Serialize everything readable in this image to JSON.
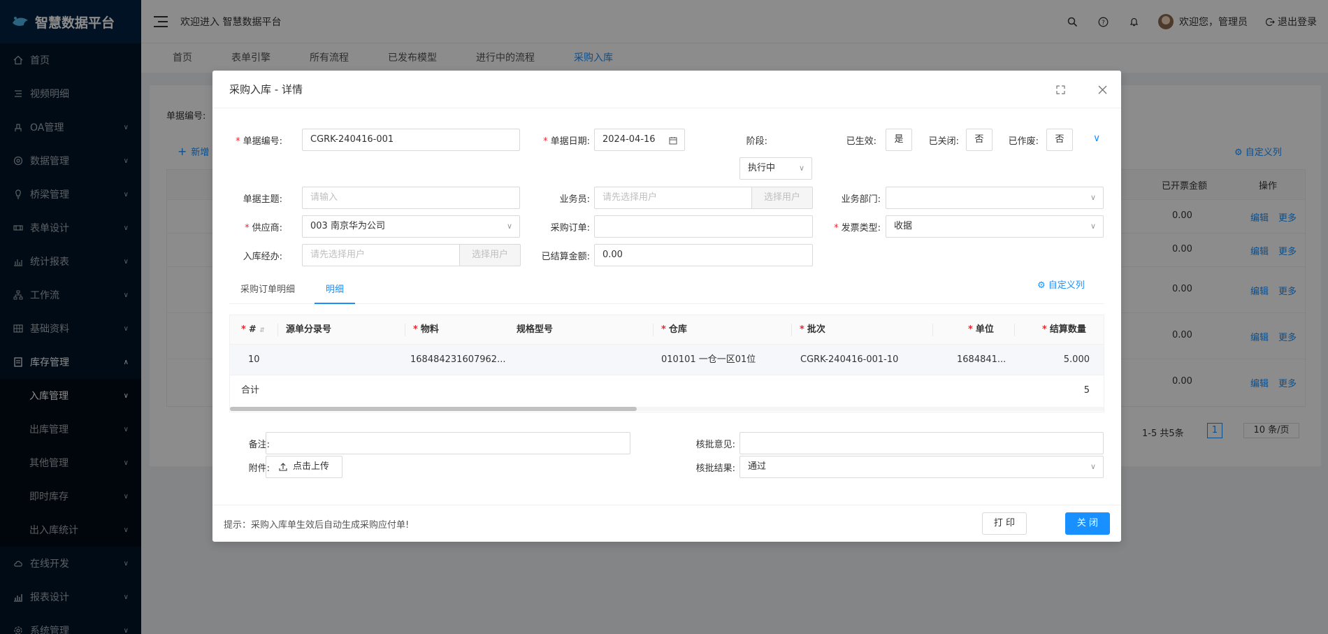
{
  "sidebar": {
    "logo_text": "智慧数据平台",
    "items": [
      {
        "label": "首页",
        "icon": "home-icon"
      },
      {
        "label": "视频明细",
        "icon": "list-icon"
      },
      {
        "label": "OA管理",
        "icon": "user-icon"
      },
      {
        "label": "数据管理",
        "icon": "database-icon"
      },
      {
        "label": "桥梁管理",
        "icon": "bulb-icon"
      },
      {
        "label": "表单设计",
        "icon": "form-icon"
      },
      {
        "label": "统计报表",
        "icon": "bar-chart-icon"
      },
      {
        "label": "工作流",
        "icon": "flow-icon"
      },
      {
        "label": "基础资料",
        "icon": "grid-icon"
      },
      {
        "label": "库存管理",
        "icon": "file-icon"
      }
    ],
    "sub_items": [
      {
        "label": "入库管理"
      },
      {
        "label": "出库管理"
      },
      {
        "label": "其他管理"
      },
      {
        "label": "即时库存"
      },
      {
        "label": "出入库统计"
      }
    ],
    "bottom_items": [
      {
        "label": "在线开发",
        "icon": "cloud-icon"
      },
      {
        "label": "报表设计",
        "icon": "chart-icon"
      },
      {
        "label": "系统管理",
        "icon": "setting-icon"
      }
    ]
  },
  "header": {
    "title": "欢迎进入 智慧数据平台",
    "user_greeting": "欢迎您，管理员",
    "logout": "退出登录"
  },
  "tabs": [
    "首页",
    "表单引擎",
    "所有流程",
    "已发布模型",
    "进行中的流程",
    "采购入库"
  ],
  "background": {
    "label_order_no": "单据编号:",
    "new_button": "新增",
    "custom_columns": "自定义列",
    "col_invoiced": "已开票金额",
    "col_ops": "操作",
    "row_values": [
      "0.00",
      "0.00",
      "0.00",
      "0.00",
      "0.00"
    ],
    "edit": "编辑",
    "more": "更多",
    "pagination_total": "1-5 共5条",
    "page_current": "1",
    "page_size": "10 条/页"
  },
  "modal": {
    "title": "采购入库 - 详情",
    "fields": {
      "order_no_label": "单据编号:",
      "order_no_value": "CGRK-240416-001",
      "order_date_label": "单据日期:",
      "order_date_value": "2024-04-16",
      "stage_label": "阶段:",
      "stage_value": "执行中",
      "effective_label": "已生效:",
      "effective_value": "是",
      "closed_label": "已关闭:",
      "closed_value": "否",
      "voided_label": "已作废:",
      "voided_value": "否",
      "subject_label": "单据主题:",
      "subject_placeholder": "请输入",
      "salesman_label": "业务员:",
      "salesman_placeholder": "请先选择用户",
      "select_user": "选择用户",
      "department_label": "业务部门:",
      "supplier_label": "供应商:",
      "supplier_value": "003 南京华为公司",
      "purchase_order_label": "采购订单:",
      "invoice_type_label": "发票类型:",
      "invoice_type_value": "收据",
      "handler_label": "入库经办:",
      "handler_placeholder": "请先选择用户",
      "settled_label": "已结算金额:",
      "settled_value": "0.00"
    },
    "custom_columns": "自定义列",
    "tabs": [
      "采购订单明细",
      "明细"
    ],
    "table": {
      "headers": [
        "#",
        "源单分录号",
        "物料",
        "规格型号",
        "仓库",
        "批次",
        "单位",
        "结算数量"
      ],
      "row": [
        "10",
        "",
        "168484231607962...",
        "",
        "010101 一仓一区01位",
        "CGRK-240416-001-10",
        "1684841...",
        "5.000"
      ],
      "sum_label": "合计",
      "sum_value": "5"
    },
    "remark_label": "备注:",
    "attachment_label": "附件:",
    "upload_button": "点击上传",
    "approval_opinion_label": "核批意见:",
    "approval_result_label": "核批结果:",
    "approval_result_value": "通过",
    "footer_hint": "提示：采购入库单生效后自动生成采购应付单!",
    "print_button": "打 印",
    "close_button": "关 闭"
  },
  "colors": {
    "primary": "#1890ff",
    "sidebar_bg": "#001529",
    "required": "#f5222d"
  }
}
